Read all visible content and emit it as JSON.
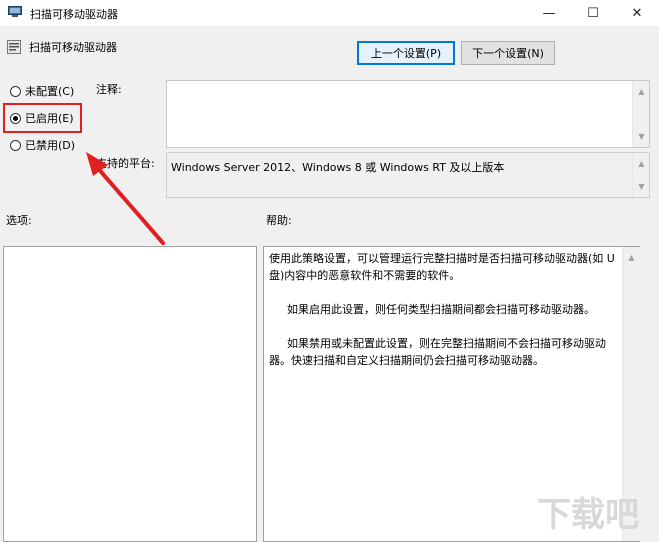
{
  "window": {
    "title": "扫描可移动驱动器",
    "minimize_glyph": "—",
    "maximize_glyph": "☐",
    "close_glyph": "✕"
  },
  "header": {
    "title": "扫描可移动驱动器"
  },
  "nav": {
    "prev_label": "上一个设置(P)",
    "next_label": "下一个设置(N)"
  },
  "state_options": [
    {
      "label": "未配置(C)",
      "checked": false
    },
    {
      "label": "已启用(E)",
      "checked": true
    },
    {
      "label": "已禁用(D)",
      "checked": false
    }
  ],
  "comment": {
    "label": "注释:",
    "value": ""
  },
  "platform": {
    "label": "支持的平台:",
    "value": "Windows Server 2012、Windows 8 或 Windows RT 及以上版本"
  },
  "options_label": "选项:",
  "help_label": "帮助:",
  "help_paragraphs": [
    "使用此策略设置，可以管理运行完整扫描时是否扫描可移动驱动器(如 U 盘)内容中的恶意软件和不需要的软件。",
    "如果启用此设置，则任何类型扫描期间都会扫描可移动驱动器。",
    "如果禁用或未配置此设置，则在完整扫描期间不会扫描可移动驱动器。快速扫描和自定义扫描期间仍会扫描可移动驱动器。"
  ],
  "watermark": "下载吧",
  "colors": {
    "annotation_red": "#e02020",
    "focus_blue": "#0078d7"
  }
}
